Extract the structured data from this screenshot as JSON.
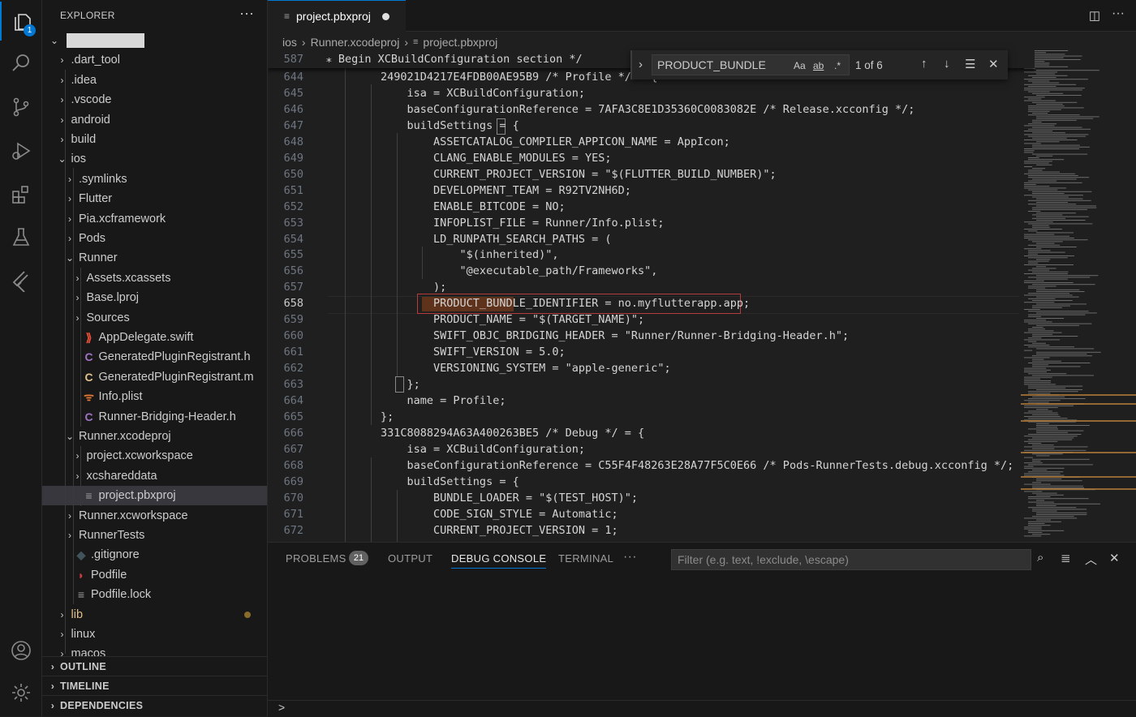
{
  "activity_bar": {
    "explorer_badge": "1"
  },
  "sidebar": {
    "title": "EXPLORER",
    "more": "···",
    "items": [
      {
        "label": "",
        "icon": "",
        "chevron": "open",
        "indent": 0,
        "color": "#cccccc"
      },
      {
        "label": ".dart_tool",
        "icon": "",
        "chevron": "closed",
        "indent": 1,
        "color": "#cccccc"
      },
      {
        "label": ".idea",
        "icon": "",
        "chevron": "closed",
        "indent": 1,
        "color": "#cccccc"
      },
      {
        "label": ".vscode",
        "icon": "",
        "chevron": "closed",
        "indent": 1,
        "color": "#cccccc"
      },
      {
        "label": "android",
        "icon": "",
        "chevron": "closed",
        "indent": 1,
        "color": "#cccccc"
      },
      {
        "label": "build",
        "icon": "",
        "chevron": "closed",
        "indent": 1,
        "color": "#cccccc"
      },
      {
        "label": "ios",
        "icon": "",
        "chevron": "open",
        "indent": 1,
        "color": "#cccccc"
      },
      {
        "label": ".symlinks",
        "icon": "",
        "chevron": "closed",
        "indent": 2,
        "color": "#cccccc"
      },
      {
        "label": "Flutter",
        "icon": "",
        "chevron": "closed",
        "indent": 2,
        "color": "#cccccc"
      },
      {
        "label": "Pia.xcframework",
        "icon": "",
        "chevron": "closed",
        "indent": 2,
        "color": "#cccccc"
      },
      {
        "label": "Pods",
        "icon": "",
        "chevron": "closed",
        "indent": 2,
        "color": "#cccccc"
      },
      {
        "label": "Runner",
        "icon": "",
        "chevron": "open",
        "indent": 2,
        "color": "#cccccc"
      },
      {
        "label": "Assets.xcassets",
        "icon": "",
        "chevron": "closed",
        "indent": 3,
        "color": "#cccccc"
      },
      {
        "label": "Base.lproj",
        "icon": "",
        "chevron": "closed",
        "indent": 3,
        "color": "#cccccc"
      },
      {
        "label": "Sources",
        "icon": "",
        "chevron": "closed",
        "indent": 3,
        "color": "#cccccc"
      },
      {
        "label": "AppDelegate.swift",
        "icon": "swift",
        "chevron": "none",
        "indent": 3,
        "color": "#cccccc"
      },
      {
        "label": "GeneratedPluginRegistrant.h",
        "icon": "c-purple",
        "chevron": "none",
        "indent": 3,
        "color": "#cccccc"
      },
      {
        "label": "GeneratedPluginRegistrant.m",
        "icon": "c-yellow",
        "chevron": "none",
        "indent": 3,
        "color": "#cccccc"
      },
      {
        "label": "Info.plist",
        "icon": "rss",
        "chevron": "none",
        "indent": 3,
        "color": "#cccccc"
      },
      {
        "label": "Runner-Bridging-Header.h",
        "icon": "c-purple",
        "chevron": "none",
        "indent": 3,
        "color": "#cccccc"
      },
      {
        "label": "Runner.xcodeproj",
        "icon": "",
        "chevron": "open",
        "indent": 2,
        "color": "#cccccc"
      },
      {
        "label": "project.xcworkspace",
        "icon": "",
        "chevron": "closed",
        "indent": 3,
        "color": "#cccccc"
      },
      {
        "label": "xcshareddata",
        "icon": "",
        "chevron": "closed",
        "indent": 3,
        "color": "#cccccc"
      },
      {
        "label": "project.pbxproj",
        "icon": "lines",
        "chevron": "none",
        "indent": 3,
        "color": "#cccccc",
        "selected": true
      },
      {
        "label": "Runner.xcworkspace",
        "icon": "",
        "chevron": "closed",
        "indent": 2,
        "color": "#cccccc"
      },
      {
        "label": "RunnerTests",
        "icon": "",
        "chevron": "closed",
        "indent": 2,
        "color": "#cccccc"
      },
      {
        "label": ".gitignore",
        "icon": "git",
        "chevron": "none",
        "indent": 2,
        "color": "#cccccc"
      },
      {
        "label": "Podfile",
        "icon": "ruby",
        "chevron": "none",
        "indent": 2,
        "color": "#cccccc"
      },
      {
        "label": "Podfile.lock",
        "icon": "lines",
        "chevron": "none",
        "indent": 2,
        "color": "#cccccc"
      },
      {
        "label": "lib",
        "icon": "",
        "chevron": "closed",
        "indent": 1,
        "color": "#e2c08d",
        "modified": true
      },
      {
        "label": "linux",
        "icon": "",
        "chevron": "closed",
        "indent": 1,
        "color": "#cccccc"
      },
      {
        "label": "macos",
        "icon": "",
        "chevron": "closed",
        "indent": 1,
        "color": "#cccccc"
      }
    ],
    "sections": [
      "OUTLINE",
      "TIMELINE",
      "DEPENDENCIES"
    ]
  },
  "editor": {
    "tab_label": "project.pbxproj",
    "breadcrumb": [
      "ios",
      "Runner.xcodeproj",
      "project.pbxproj"
    ],
    "sticky": {
      "num": "587",
      "text": "⁎ Begin XCBuildConfiguration section */"
    },
    "current_line": "658",
    "lines": [
      {
        "num": "644",
        "text": "        249021D4217E4FDB00AE95B9 /* Profile */ = {"
      },
      {
        "num": "645",
        "text": "            isa = XCBuildConfiguration;"
      },
      {
        "num": "646",
        "text": "            baseConfigurationReference = 7AFA3C8E1D35360C0083082E /* Release.xcconfig */;"
      },
      {
        "num": "647",
        "text": "            buildSettings = {"
      },
      {
        "num": "648",
        "text": "                ASSETCATALOG_COMPILER_APPICON_NAME = AppIcon;"
      },
      {
        "num": "649",
        "text": "                CLANG_ENABLE_MODULES = YES;"
      },
      {
        "num": "650",
        "text": "                CURRENT_PROJECT_VERSION = \"$(FLUTTER_BUILD_NUMBER)\";"
      },
      {
        "num": "651",
        "text": "                DEVELOPMENT_TEAM = R92TV2NH6D;"
      },
      {
        "num": "652",
        "text": "                ENABLE_BITCODE = NO;"
      },
      {
        "num": "653",
        "text": "                INFOPLIST_FILE = Runner/Info.plist;"
      },
      {
        "num": "654",
        "text": "                LD_RUNPATH_SEARCH_PATHS = ("
      },
      {
        "num": "655",
        "text": "                    \"$(inherited)\","
      },
      {
        "num": "656",
        "text": "                    \"@executable_path/Frameworks\","
      },
      {
        "num": "657",
        "text": "                );"
      },
      {
        "num": "658",
        "text": "                PRODUCT_BUNDLE_IDENTIFIER = no.myflutterapp.app;"
      },
      {
        "num": "659",
        "text": "                PRODUCT_NAME = \"$(TARGET_NAME)\";"
      },
      {
        "num": "660",
        "text": "                SWIFT_OBJC_BRIDGING_HEADER = \"Runner/Runner-Bridging-Header.h\";"
      },
      {
        "num": "661",
        "text": "                SWIFT_VERSION = 5.0;"
      },
      {
        "num": "662",
        "text": "                VERSIONING_SYSTEM = \"apple-generic\";"
      },
      {
        "num": "663",
        "text": "            };"
      },
      {
        "num": "664",
        "text": "            name = Profile;"
      },
      {
        "num": "665",
        "text": "        };"
      },
      {
        "num": "666",
        "text": "        331C8088294A63A400263BE5 /* Debug */ = {"
      },
      {
        "num": "667",
        "text": "            isa = XCBuildConfiguration;"
      },
      {
        "num": "668",
        "text": "            baseConfigurationReference = C55F4F48263E28A77F5C0E66 /* Pods-RunnerTests.debug.xcconfig */;"
      },
      {
        "num": "669",
        "text": "            buildSettings = {"
      },
      {
        "num": "670",
        "text": "                BUNDLE_LOADER = \"$(TEST_HOST)\";"
      },
      {
        "num": "671",
        "text": "                CODE_SIGN_STYLE = Automatic;"
      },
      {
        "num": "672",
        "text": "                CURRENT_PROJECT_VERSION = 1;"
      }
    ]
  },
  "find": {
    "value": "PRODUCT_BUNDLE",
    "match_case": "Aa",
    "whole_word": "ab",
    "regex": ".*",
    "count": "1 of 6"
  },
  "panel": {
    "tabs": [
      "PROBLEMS",
      "OUTPUT",
      "DEBUG CONSOLE",
      "TERMINAL"
    ],
    "active_tab": "DEBUG CONSOLE",
    "problems_count": "21",
    "more": "···",
    "filter_placeholder": "Filter (e.g. text, !exclude, \\escape)",
    "prompt": ">"
  },
  "colors": {
    "accent": "#0078d4",
    "modified": "#e2c08d",
    "match_border": "#b43c3c"
  }
}
